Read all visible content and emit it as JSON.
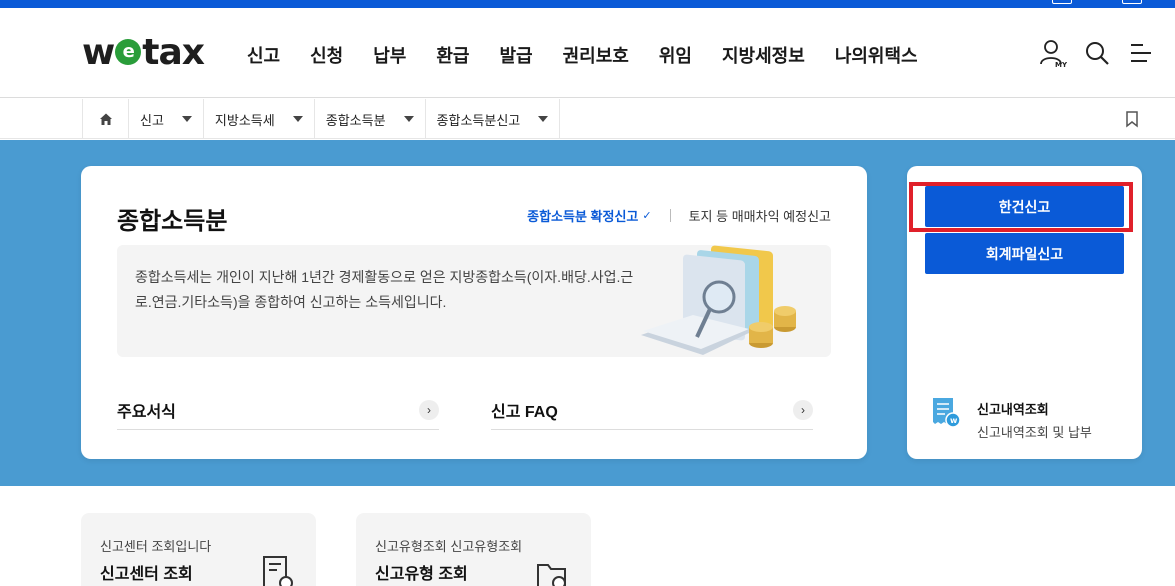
{
  "logo": {
    "pre": "w",
    "mid": "e",
    "post": "tax"
  },
  "gnb": [
    "신고",
    "신청",
    "납부",
    "환급",
    "발급",
    "권리보호",
    "위임",
    "지방세정보",
    "나의위택스"
  ],
  "header_icons": [
    "my-user-icon",
    "search-icon",
    "menu-icon"
  ],
  "breadcrumb": {
    "home_icon": "home-icon",
    "items": [
      "신고",
      "지방소득세",
      "종합소득분",
      "종합소득분신고"
    ]
  },
  "main_card": {
    "title": "종합소득분",
    "tab_active": "종합소득분 확정신고",
    "tab_check": "✓",
    "tab_other": "토지 등 매매차익 예정신고",
    "description": "종합소득세는 개인이 지난해 1년간 경제활동으로 얻은 지방종합소득(이자.배당.사업.근로.연금.기타소득)을 종합하여 신고하는 소득세입니다.",
    "links": [
      {
        "label": "주요서식",
        "arrow": "›"
      },
      {
        "label": "신고 FAQ",
        "arrow": "›"
      }
    ]
  },
  "side_card": {
    "button_single": "한건신고",
    "button_file": "회계파일신고",
    "history_title": "신고내역조회",
    "history_sub": "신고내역조회 및 납부"
  },
  "bottom_cards": [
    {
      "sub": "신고센터 조회입니다",
      "title": "신고센터 조회"
    },
    {
      "sub": "신고유형조회 신고유형조회",
      "title": "신고유형 조회"
    }
  ],
  "colors": {
    "primary": "#0a5ad7",
    "band": "#4a9bd1",
    "highlight": "#e0202a",
    "logo_e": "#2a9d3a"
  }
}
